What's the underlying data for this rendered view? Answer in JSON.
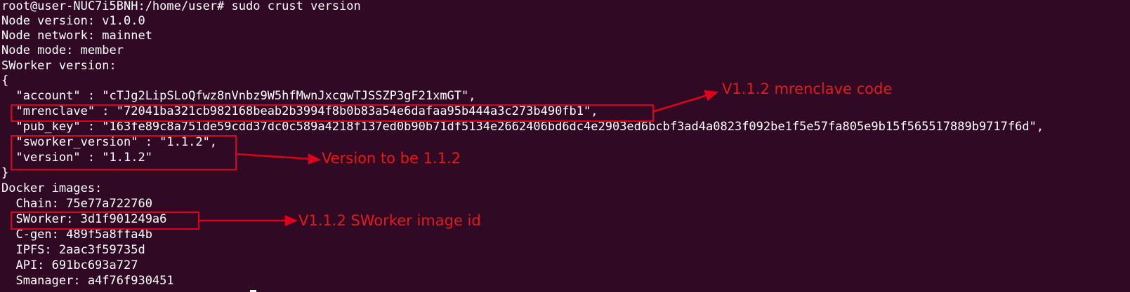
{
  "terminal": {
    "lines": [
      "root@user-NUC7i5BNH:/home/user# sudo crust version",
      "Node version: v1.0.0",
      "Node network: mainnet",
      "Node mode: member",
      "SWorker version:",
      "{",
      "  \"account\" : \"cTJg2LipSLoQfwz8nVnbz9W5hfMwnJxcgwTJSSZP3gF21xmGT\",",
      "  \"mrenclave\" : \"72041ba321cb982168beab2b3994f8b0b83a54e6dafaa95b444a3c273b490fb1\",",
      "  \"pub_key\" : \"163fe89c8a751de59cdd37dc0c589a4218f137ed0b90b71df5134e2662406bd6dc4e2903ed6bcbf3ad4a0823f092be1f5e57fa805e9b15f565517889b9717f6d\",",
      "  \"sworker_version\" : \"1.1.2\",",
      "  \"version\" : \"1.1.2\"",
      "}",
      "Docker images:",
      "  Chain: 75e77a722760",
      "  SWorker: 3d1f901249a6",
      "  C-gen: 489f5a8ffa4b",
      "  IPFS: 2aac3f59735d",
      "  API: 691bc693a727",
      "  Smanager: a4f76f930451"
    ]
  },
  "annotations": {
    "mrenclave": "V1.1.2 mrenclave code",
    "version": "Version to be 1.1.2",
    "sworker_image": "V1.1.2 SWorker image id"
  },
  "colors": {
    "terminal_background": "#300a24",
    "terminal_text": "#ffffff",
    "annotation_red": "#e51a1a"
  }
}
